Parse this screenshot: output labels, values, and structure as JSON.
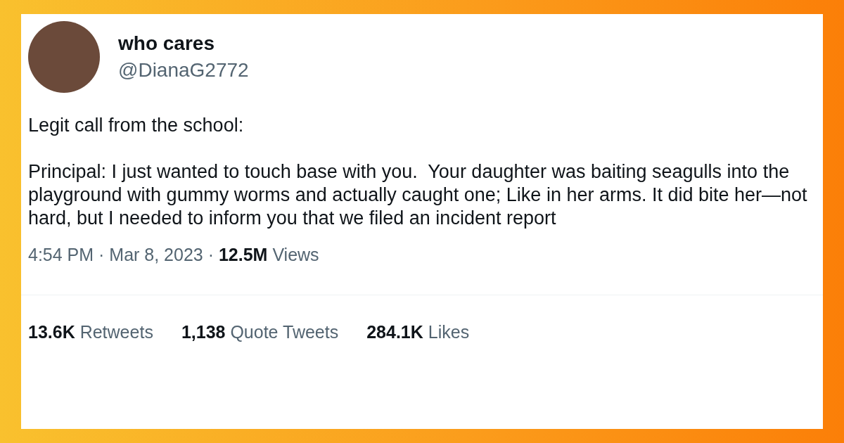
{
  "tweet": {
    "display_name": "who cares",
    "handle": "@DianaG2772",
    "paragraphs": [
      "Legit call from the school:",
      "Principal: I just wanted to touch base with you.  Your daughter was baiting seagulls into the playground with gummy worms and actually caught one; Like in her arms. It did bite her—not hard, but I needed to inform you that we filed an incident report"
    ],
    "meta": "4:54 PM · Mar 8, 2023 · **12.5M** Views",
    "stats": [
      "**13.6K** Retweets",
      "**1,138** Quote Tweets",
      "**284.1K** Likes"
    ]
  }
}
